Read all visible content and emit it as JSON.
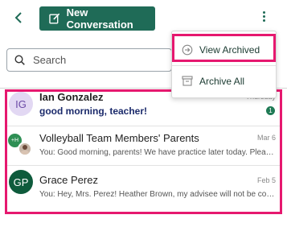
{
  "header": {
    "new_conversation_label": "New Conversation"
  },
  "search": {
    "placeholder": "Search"
  },
  "conversations": [
    {
      "initials": "IG",
      "name": "Ian Gonzalez",
      "time": "Thursday",
      "preview": "good morning, teacher!",
      "unread_count": "1"
    },
    {
      "initials": "+H",
      "name": "Volleyball Team Members' Parents",
      "time": "Mar 6",
      "preview": "You:  Good morning, parents! We have practice later today. Please..."
    },
    {
      "initials": "GP",
      "name": "Grace Perez",
      "time": "Feb 5",
      "preview": "You:  Hey, Mrs. Perez! Heather Brown, my advisee will not be coming..."
    }
  ],
  "menu": {
    "view_archived": "View Archived",
    "archive_all": "Archive All"
  },
  "colors": {
    "brand": "#1f6b57",
    "highlight": "#e6186f"
  }
}
